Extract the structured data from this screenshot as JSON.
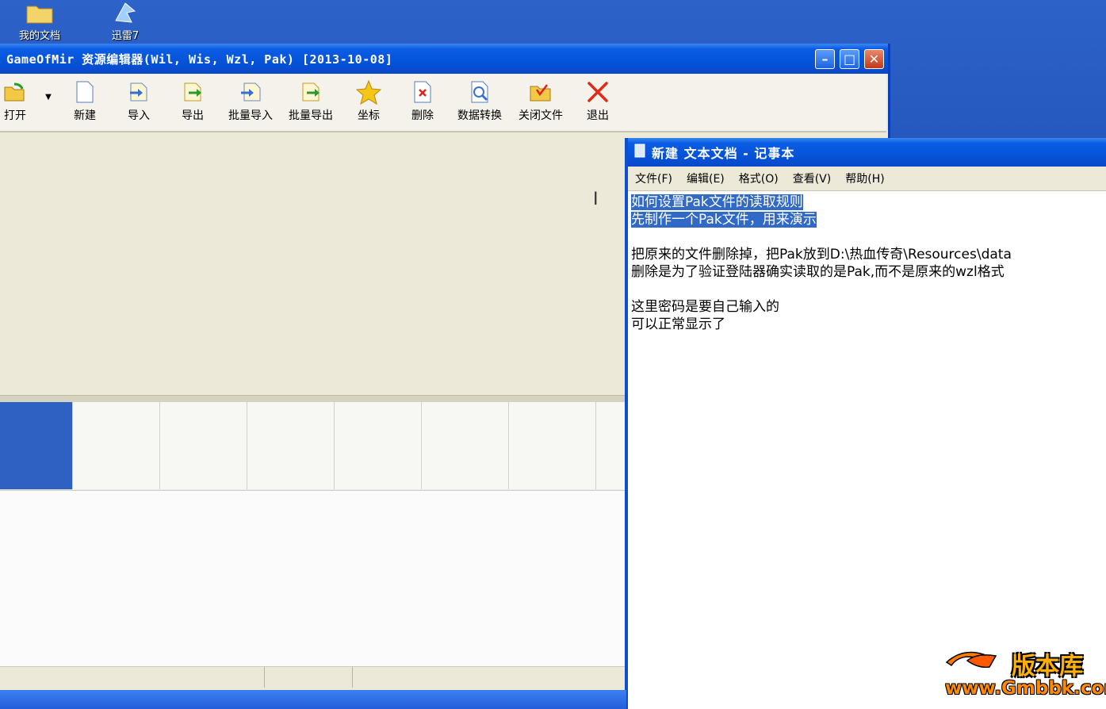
{
  "desktop": {
    "icons": [
      {
        "label": "我的文档"
      },
      {
        "label": "迅雷7"
      }
    ]
  },
  "main_window": {
    "title": "GameOfMir 资源编辑器(Wil, Wis, Wzl, Pak) [2013-10-08]",
    "toolbar": [
      {
        "label": "打开",
        "icon": "folder-open-icon"
      },
      {
        "label": "新建",
        "icon": "new-file-icon"
      },
      {
        "label": "导入",
        "icon": "import-icon"
      },
      {
        "label": "导出",
        "icon": "export-icon"
      },
      {
        "label": "批量导入",
        "icon": "batch-import-icon"
      },
      {
        "label": "批量导出",
        "icon": "batch-export-icon"
      },
      {
        "label": "坐标",
        "icon": "star-icon"
      },
      {
        "label": "删除",
        "icon": "delete-icon"
      },
      {
        "label": "数据转换",
        "icon": "convert-icon"
      },
      {
        "label": "关闭文件",
        "icon": "close-file-icon"
      },
      {
        "label": "退出",
        "icon": "exit-icon"
      }
    ]
  },
  "notepad": {
    "title": "新建 文本文档 - 记事本",
    "menu": [
      "文件(F)",
      "编辑(E)",
      "格式(O)",
      "查看(V)",
      "帮助(H)"
    ],
    "lines": {
      "l1": "如何设置Pak文件的读取规则",
      "l2": "先制作一个Pak文件，用来演示",
      "l3": "把原来的文件删除掉，把Pak放到D:\\热血传奇\\Resources\\data",
      "l4": "删除是为了验证登陆器确实读取的是Pak,而不是原来的wzl格式",
      "l5": "这里密码是要自己输入的",
      "l6": "可以正常显示了"
    }
  },
  "watermark": {
    "brand": "版本库",
    "url": "www.Gmbbk.com"
  },
  "colors": {
    "title_blue": "#0553d8",
    "selection": "#3169c6",
    "watermark_orange": "#ff8a00"
  }
}
